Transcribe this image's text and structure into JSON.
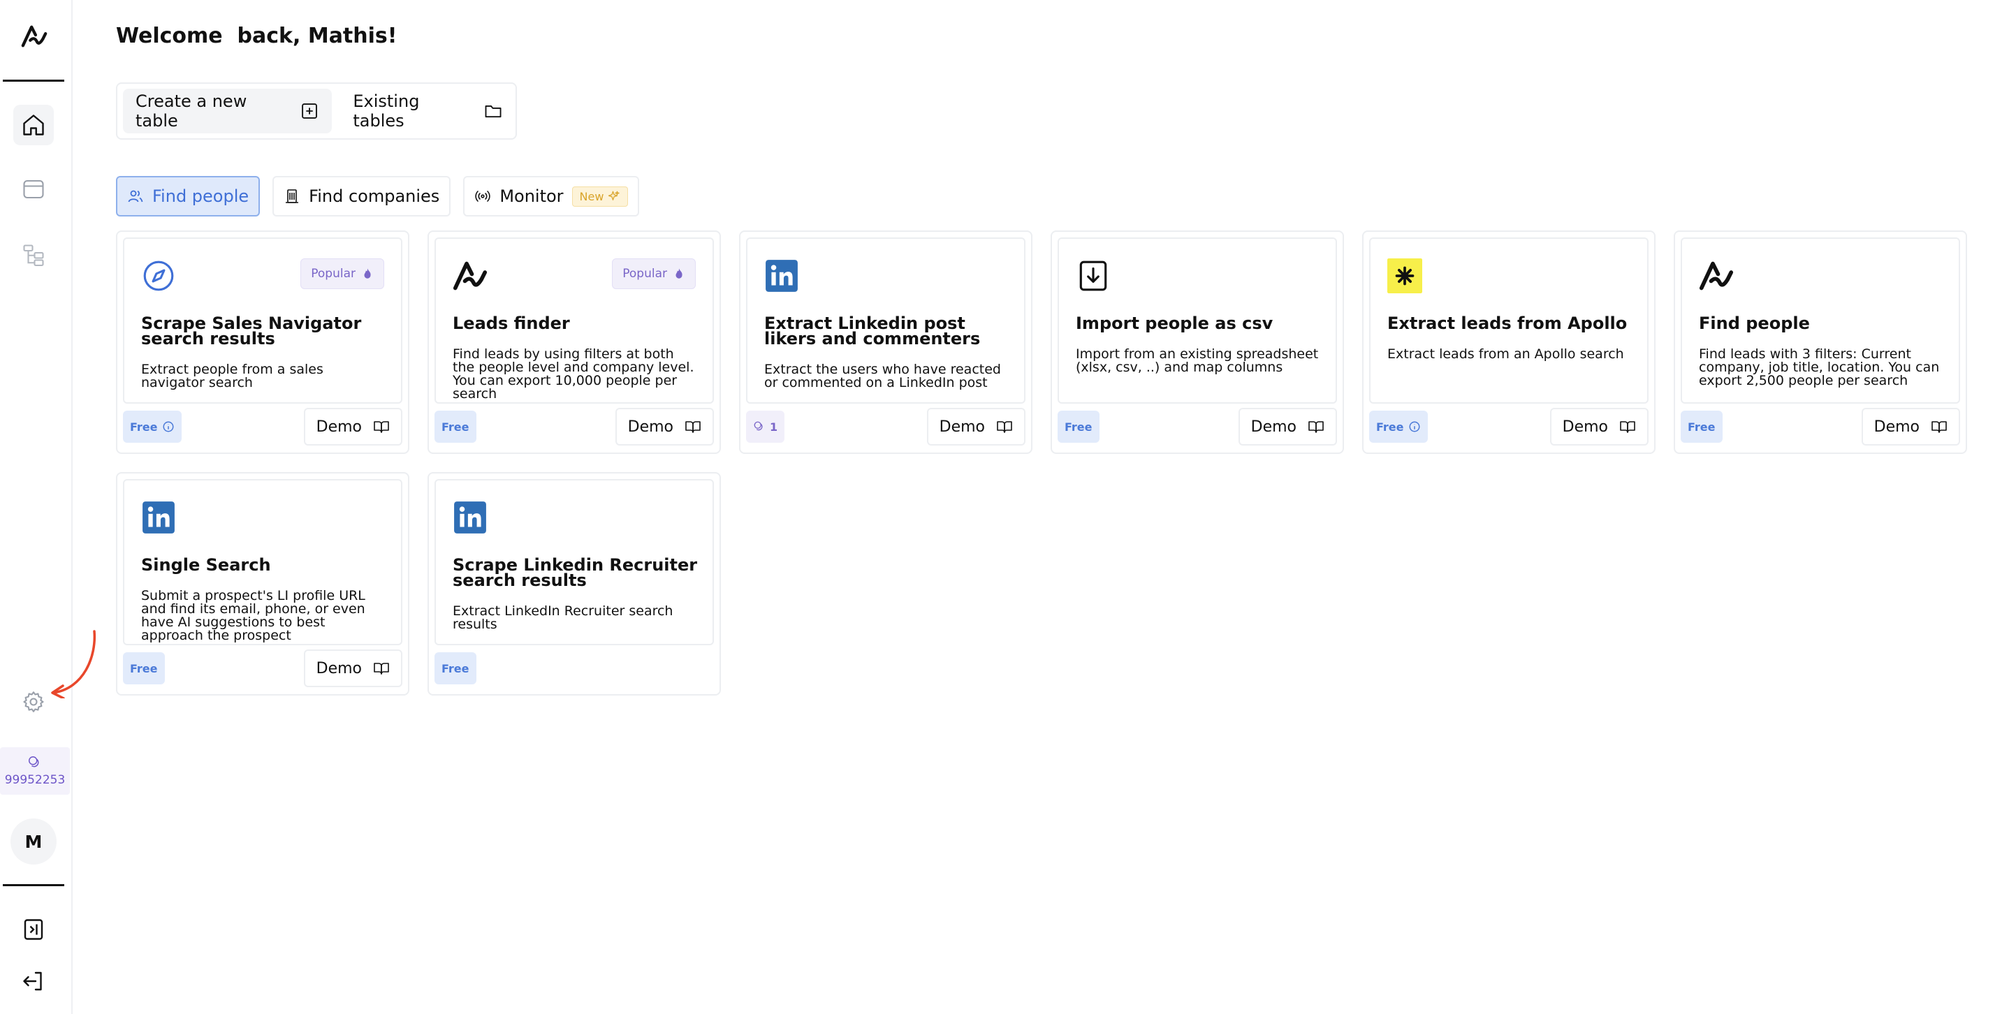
{
  "sidebar": {
    "credits_value": "99952253",
    "avatar_initial": "M"
  },
  "header": {
    "welcome": "Welcome  back, Mathis!"
  },
  "tablebar": {
    "create_label": "Create a new table",
    "existing_label": "Existing tables"
  },
  "tabs": {
    "find_people": "Find people",
    "find_companies": "Find companies",
    "monitor": "Monitor",
    "monitor_badge": "New"
  },
  "cards": [
    {
      "title": "Scrape Sales Navigator search results",
      "desc": "Extract people from a sales navigator search",
      "badge": "Popular",
      "price": "Free",
      "demo": "Demo",
      "icon": "compass-icon"
    },
    {
      "title": "Leads finder",
      "desc": "Find leads by using filters at both the people level and company level. You can export 10,000 people per search",
      "badge": "Popular",
      "price": "Free",
      "demo": "Demo",
      "icon": "brand-logo-icon"
    },
    {
      "title": "Extract Linkedin post likers and commenters",
      "desc": "Extract the users who have reacted or commented on a LinkedIn post",
      "badge": "",
      "price": "1",
      "demo": "Demo",
      "icon": "linkedin-icon"
    },
    {
      "title": "Import people as csv",
      "desc": "Import from an existing spreadsheet (xlsx, csv, ..) and map columns",
      "badge": "",
      "price": "Free",
      "demo": "Demo",
      "icon": "download-file-icon"
    },
    {
      "title": "Extract leads from Apollo",
      "desc": "Extract leads from an Apollo search",
      "badge": "",
      "price": "Free",
      "demo": "Demo",
      "icon": "apollo-icon"
    },
    {
      "title": "Find people",
      "desc": "Find leads with 3 filters: Current company, job title, location. You can export 2,500 people per search",
      "badge": "",
      "price": "Free",
      "demo": "Demo",
      "icon": "brand-logo-icon"
    },
    {
      "title": "Single Search",
      "desc": "Submit a prospect's LI profile URL and find its email, phone, or even have AI suggestions to best approach the prospect",
      "badge": "",
      "price": "Free",
      "demo": "Demo",
      "icon": "linkedin-icon"
    },
    {
      "title": "Scrape Linkedin Recruiter search results",
      "desc": "Extract LinkedIn Recruiter search results",
      "badge": "",
      "price": "Free",
      "demo": "",
      "icon": "linkedin-icon"
    }
  ],
  "colors": {
    "accent": "#3f6fd6",
    "popular": "#7a66c8",
    "linkedin": "#2f6eb5",
    "apollo": "#f7ef4a",
    "arrow": "#e8472b"
  }
}
